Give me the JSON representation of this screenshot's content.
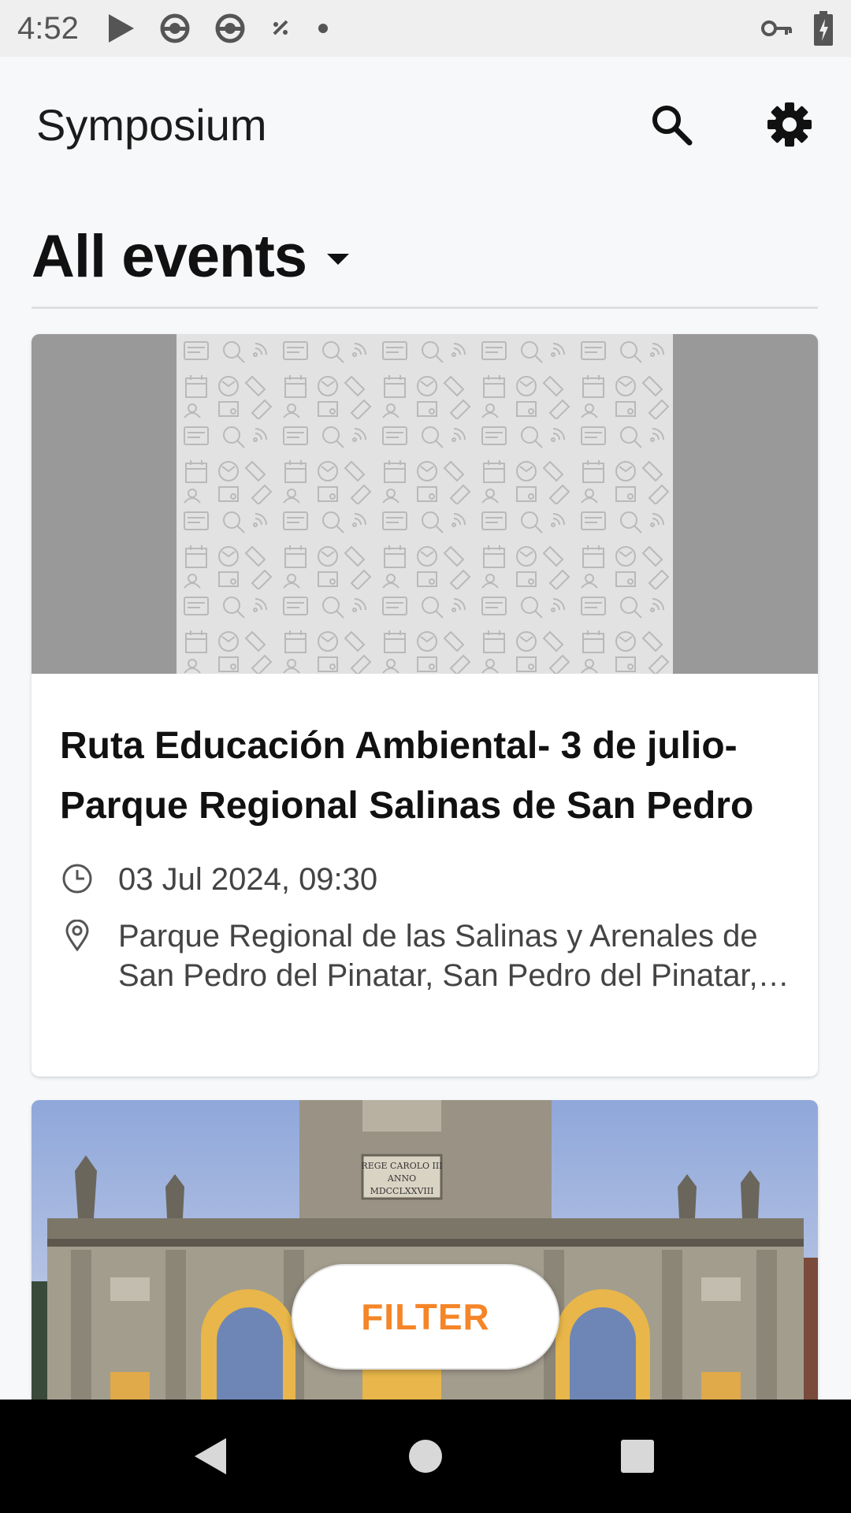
{
  "status_bar": {
    "time": "4:52",
    "icons_left": [
      "play-icon",
      "sync-icon",
      "sync-icon",
      "sparkle-icon",
      "dot-icon"
    ],
    "icons_right": [
      "vpn-key-icon",
      "battery-charging-icon"
    ]
  },
  "app_bar": {
    "title": "Symposium",
    "actions": [
      "search-icon",
      "settings-icon"
    ]
  },
  "section": {
    "title": "All events"
  },
  "events": [
    {
      "title": "Ruta Educación Ambiental- 3 de julio-Parque Regional Salinas de San Pedro",
      "datetime": "03 Jul 2024, 09:30",
      "location": "Parque Regional de las Salinas y Arenales de San Pedro del Pinatar, San Pedro del Pinatar, …",
      "image": "placeholder-pattern"
    },
    {
      "image": "puerta-de-alcala-photo",
      "inscription_line1": "REGE CAROLO III",
      "inscription_line2": "ANNO",
      "inscription_line3": "MDCCLXXVIII"
    }
  ],
  "filter_button": {
    "label": "FILTER",
    "color": "#f58527"
  },
  "nav_bar": {
    "buttons": [
      "back-icon",
      "home-icon",
      "recents-icon"
    ]
  },
  "colors": {
    "accent": "#f58527",
    "background": "#f7f8fa",
    "status_bar": "#efefef"
  }
}
